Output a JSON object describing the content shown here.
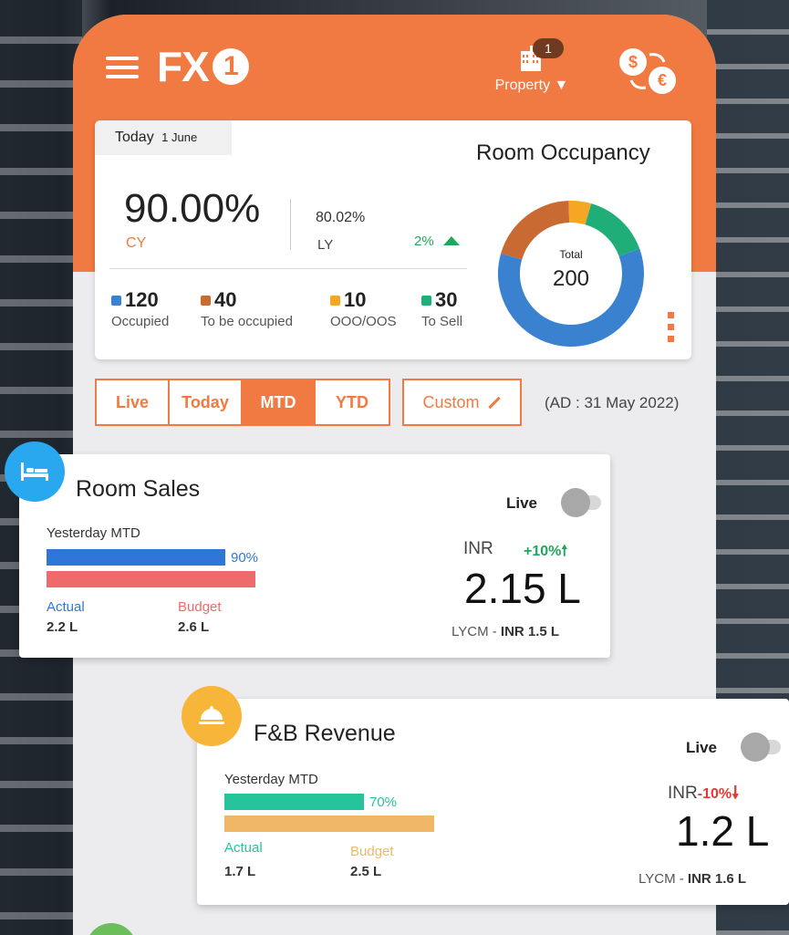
{
  "header": {
    "logo_text": "FX",
    "logo_circle": "1",
    "property_label": "Property",
    "property_badge": "1"
  },
  "occupancy": {
    "today_label": "Today",
    "today_date": "1 June",
    "title": "Room Occupancy",
    "cy_value": "90.00%",
    "cy_label": "CY",
    "ly_value": "80.02%",
    "ly_label": "LY",
    "ly_change": "2%",
    "stats": [
      {
        "value": "120",
        "label": "Occupied",
        "color": "#3a82d0"
      },
      {
        "value": "40",
        "label": "To be occupied",
        "color": "#c96a33"
      },
      {
        "value": "10",
        "label": "OOO/OOS",
        "color": "#f5a623"
      },
      {
        "value": "30",
        "label": "To Sell",
        "color": "#1fae78"
      }
    ],
    "donut_total_label": "Total",
    "donut_total": "200"
  },
  "periods": {
    "tabs": [
      "Live",
      "Today",
      "MTD",
      "YTD"
    ],
    "active": "MTD",
    "custom_label": "Custom",
    "ad_date": "(AD : 31 May 2022)"
  },
  "room_sales": {
    "title": "Room Sales",
    "live_label": "Live",
    "period_label": "Yesterday MTD",
    "actual_pct": "90%",
    "actual_fraction": 0.9,
    "actual_label": "Actual",
    "actual_value": "2.2 L",
    "budget_label": "Budget",
    "budget_value": "2.6 L",
    "currency": "INR",
    "change": "+10%",
    "value": "2.15 L",
    "lycm_prefix": "LYCM - ",
    "lycm_value": "INR 1.5 L",
    "actual_color": "#2f77d6",
    "budget_color": "#ef6b6b"
  },
  "fb_revenue": {
    "title": "F&B Revenue",
    "live_label": "Live",
    "period_label": "Yesterday MTD",
    "actual_pct": "70%",
    "actual_fraction": 0.7,
    "actual_label": "Actual",
    "actual_value": "1.7 L",
    "budget_label": "Budget",
    "budget_value": "2.5 L",
    "currency": "INR",
    "change": "-10%",
    "value": "1.2 L",
    "lycm_prefix": "LYCM - ",
    "lycm_value": "INR 1.6 L",
    "actual_color": "#26c49a",
    "budget_color": "#f0b866"
  },
  "colors": {
    "brand": "#f07a41",
    "positive": "#1fa85b",
    "negative": "#e53935"
  }
}
